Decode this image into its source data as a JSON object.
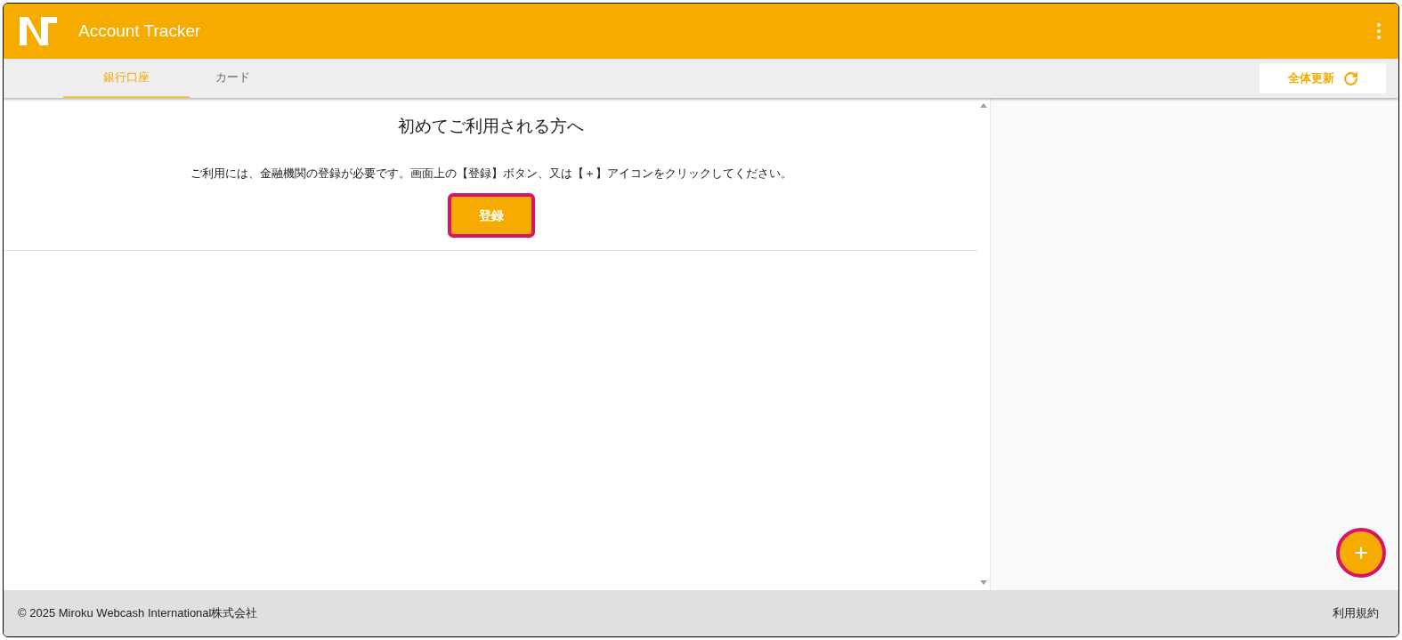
{
  "app_bar": {
    "title": "Account Tracker"
  },
  "tabs": [
    {
      "label": "銀行口座",
      "selected": true
    },
    {
      "label": "カード",
      "selected": false
    }
  ],
  "refresh_button": {
    "label": "全体更新"
  },
  "welcome": {
    "heading": "初めてご利用される方へ",
    "message": "ご利用には、金融機関の登録が必要です。画面上の【登録】ボタン、又は【＋】アイコンをクリックしてください。",
    "register_button": "登録"
  },
  "footer": {
    "copyright": "© 2025 Miroku Webcash International株式会社",
    "terms_link": "利用規約"
  }
}
